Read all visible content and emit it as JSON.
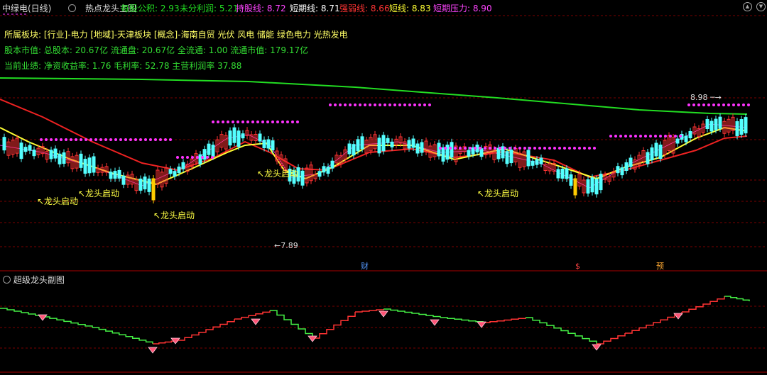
{
  "header": {
    "stock": "中绿电(日线)",
    "indicator": "热点龙头主图",
    "items": [
      {
        "label": "每股公积:",
        "value": "2.93",
        "color": "#22dd22"
      },
      {
        "label": "未分利润:",
        "value": "5.21",
        "color": "#22dd22"
      },
      {
        "label": "持股线:",
        "value": "8.72",
        "color": "#ff44ff"
      },
      {
        "label": "短期线:",
        "value": "8.71",
        "color": "#ffffff"
      },
      {
        "label": "强弱线:",
        "value": "8.66",
        "color": "#ff3333"
      },
      {
        "label": "短线:",
        "value": "8.83",
        "color": "#ffff33"
      },
      {
        "label": "短期压力:",
        "value": "8.90",
        "color": "#ff44ff"
      }
    ]
  },
  "info": {
    "sector_line": "所属板块: [行业]-电力 [地域]-天津板块 [概念]-海南自贸 光伏 风电 储能 绿色电力 光热发电",
    "capital_line": "股本市值: 总股本: 20.67亿 流通盘: 20.67亿 全流通: 1.00 流通市值: 179.17亿",
    "perf_line": "当前业绩: 净资收益率: 1.76 毛利率: 52.78 主营利润率 37.88"
  },
  "chart_data": [
    {
      "type": "candlestick",
      "annotations": [
        {
          "text": "↖龙头启动"
        },
        {
          "text": "↖龙头启动"
        },
        {
          "text": "↖龙头启动"
        },
        {
          "text": "↖龙头启动"
        },
        {
          "text": "↖龙头启动"
        }
      ],
      "price_labels": [
        "8.98",
        "7.89"
      ],
      "event_markers": [
        "财",
        "$",
        "预"
      ],
      "colors": {
        "up": "#ff3333",
        "down": "#54ffff",
        "signal": "#ffcc00",
        "long_line": "#22dd22",
        "mid_line": "#ee2222",
        "short_line": "#ffff33",
        "dots": "#ff33ff"
      }
    },
    {
      "type": "line",
      "title": "超级龙头副图",
      "colors": {
        "up": "#ff3333",
        "down": "#44ee44",
        "marker": "#ff5577"
      }
    }
  ]
}
